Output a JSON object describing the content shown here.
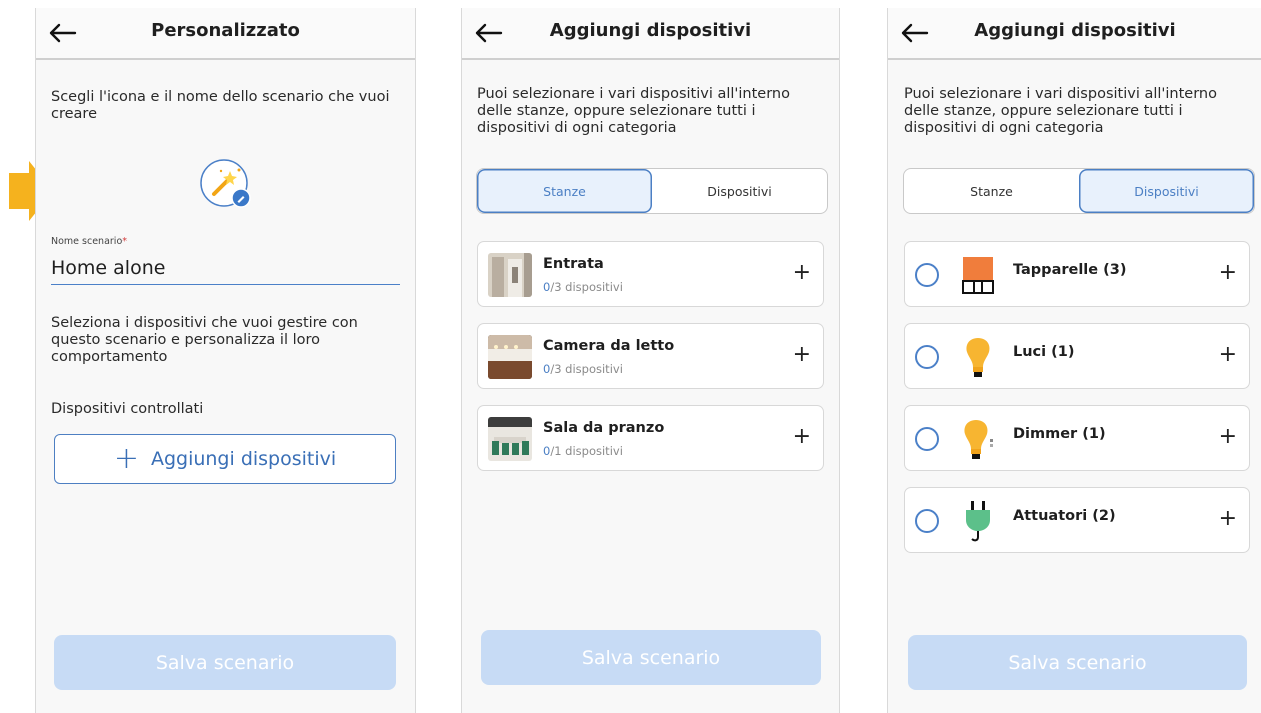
{
  "colors": {
    "accent": "#4b7fc4",
    "save_disabled": "#c7dbf5",
    "marker": "#f5b21e"
  },
  "screen1": {
    "title": "Personalizzato",
    "intro": "Scegli l'icona e il nome dello scenario che vuoi creare",
    "scenario_icon": "magic-wand-icon",
    "field_label": "Nome scenario",
    "field_required": "*",
    "field_value": "Home alone",
    "help": "Seleziona i dispositivi che vuoi gestire con questo scenario e personalizza il loro comportamento",
    "devices_heading": "Dispositivi controllati",
    "add_button": "Aggiungi dispositivi",
    "save_button": "Salva scenario"
  },
  "screen2": {
    "title": "Aggiungi dispositivi",
    "intro": "Puoi selezionare i vari dispositivi all'interno delle stanze, oppure selezionare tutti i dispositivi di ogni categoria",
    "tabs": [
      "Stanze",
      "Dispositivi"
    ],
    "active_tab": "Stanze",
    "rooms": [
      {
        "name": "Entrata",
        "selected": "0",
        "total": "/3 dispositivi"
      },
      {
        "name": "Camera da letto",
        "selected": "0",
        "total": "/3 dispositivi"
      },
      {
        "name": "Sala da pranzo",
        "selected": "0",
        "total": "/1 dispositivi"
      }
    ],
    "save_button": "Salva scenario"
  },
  "screen3": {
    "title": "Aggiungi dispositivi",
    "intro": "Puoi selezionare i vari dispositivi all'interno delle stanze, oppure selezionare tutti i dispositivi di ogni categoria",
    "tabs": [
      "Stanze",
      "Dispositivi"
    ],
    "active_tab": "Dispositivi",
    "categories": [
      {
        "label": "Tapparelle (3)",
        "icon": "shutter-icon"
      },
      {
        "label": "Luci (1)",
        "icon": "bulb-icon"
      },
      {
        "label": "Dimmer (1)",
        "icon": "dimmer-icon"
      },
      {
        "label": "Attuatori (2)",
        "icon": "plug-icon"
      }
    ],
    "save_button": "Salva scenario"
  }
}
